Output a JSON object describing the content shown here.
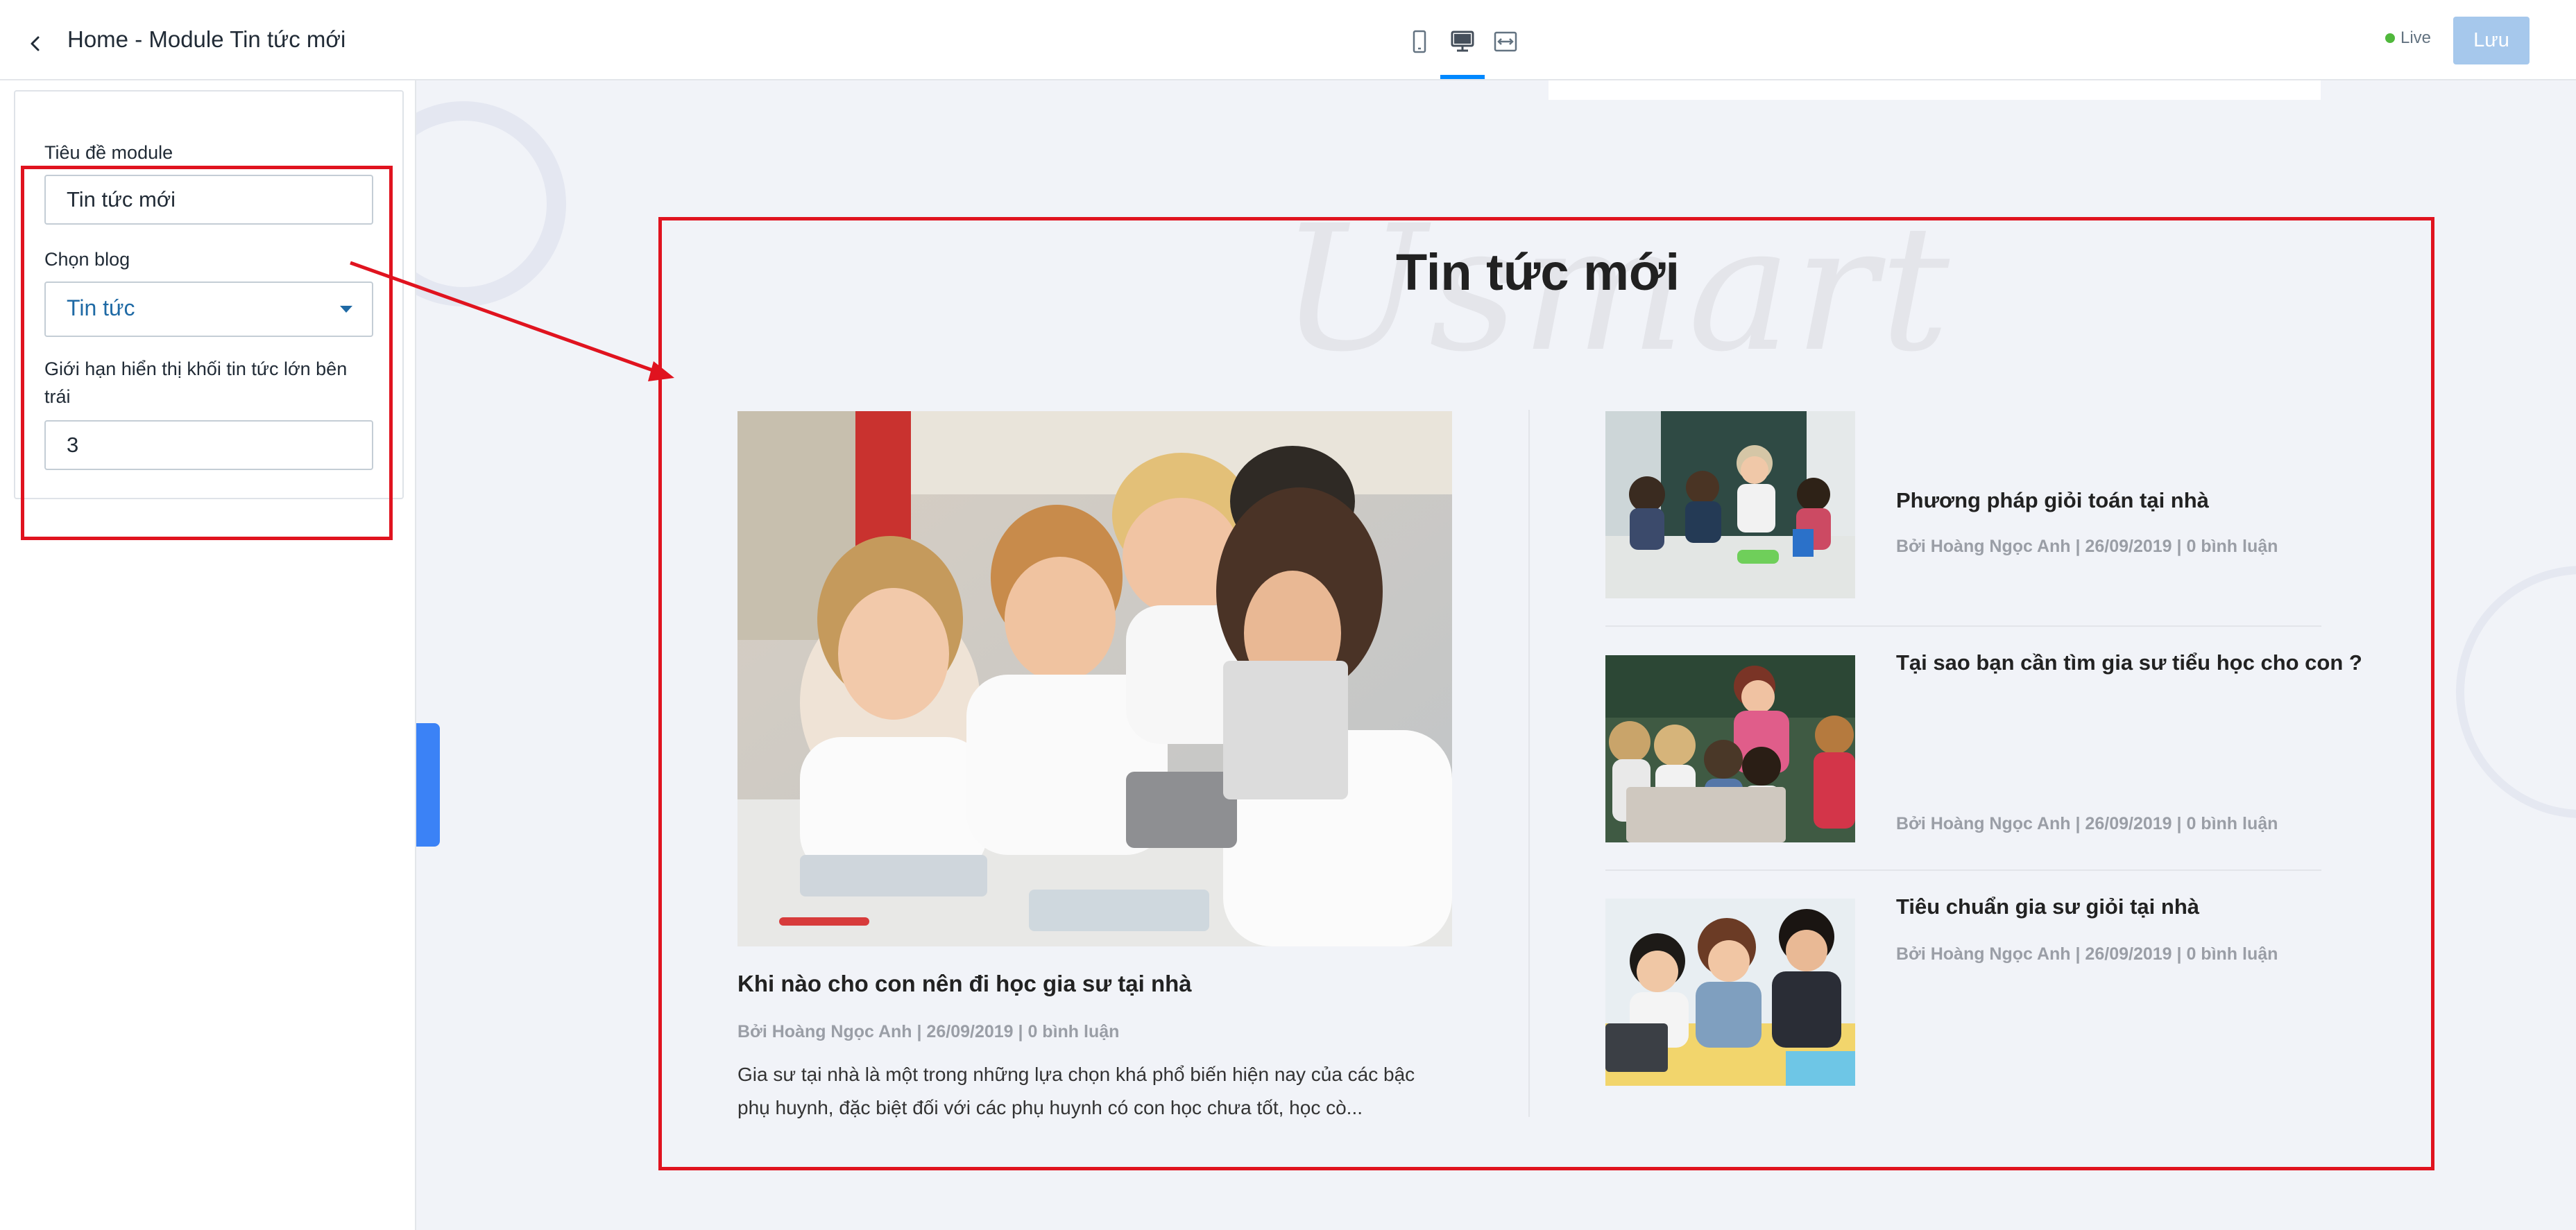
{
  "header": {
    "title": "Home - Module Tin tức mới",
    "live_label": "Live",
    "save_label": "Lưu",
    "devices": [
      "mobile-icon",
      "desktop-icon",
      "fullwidth-icon"
    ],
    "active_device": "desktop-icon"
  },
  "sidebar": {
    "fields": {
      "module_title_label": "Tiêu đề module",
      "module_title_value": "Tin tức mới",
      "blog_label": "Chọn blog",
      "blog_value": "Tin tức",
      "limit_label": "Giới hạn hiển thị khối tin tức lớn bên trái",
      "limit_value": "3"
    }
  },
  "preview": {
    "watermark": "Usmart",
    "section_title": "Tin tức mới",
    "main_article": {
      "title": "Khi nào cho con nên đi học gia sư tại nhà",
      "meta": "Bởi Hoàng Ngọc Anh | 26/09/2019 | 0 bình luận",
      "excerpt": "Gia sư tại nhà là một trong những lựa chọn khá phổ biến hiện nay của các bậc phụ huynh, đặc biệt đối với các phụ huynh có con học chưa tốt, học cò..."
    },
    "side_articles": [
      {
        "title": "Phương pháp giỏi toán tại nhà",
        "meta": "Bởi Hoàng Ngọc Anh | 26/09/2019 | 0 bình luận"
      },
      {
        "title": "Tại sao bạn cần tìm gia sư tiểu học cho con ?",
        "meta": "Bởi Hoàng Ngọc Anh | 26/09/2019 | 0 bình luận"
      },
      {
        "title": "Tiêu chuẩn gia sư giỏi tại nhà",
        "meta": "Bởi Hoàng Ngọc Anh | 26/09/2019 | 0 bình luận"
      }
    ]
  },
  "colors": {
    "accent": "#0088ff",
    "annotation_red": "#e0131f",
    "save_button": "#a6c8ec",
    "live_dot": "#50b83c"
  }
}
